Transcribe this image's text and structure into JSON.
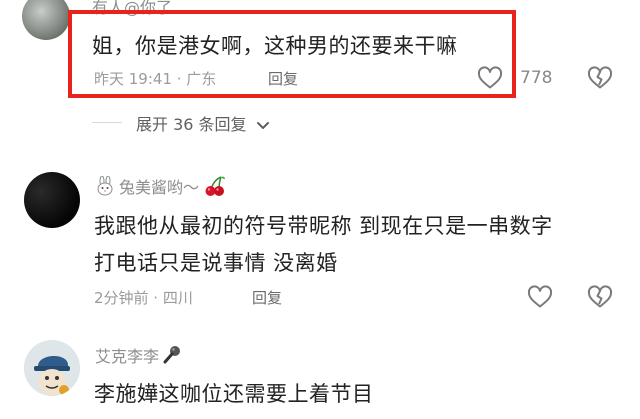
{
  "comments": [
    {
      "username": "有人@你了",
      "text": "姐，你是港女啊，这种男的还要来干嘛",
      "time_location": "昨天 19:41 · 广东",
      "reply_label": "回复",
      "like_count": "778"
    },
    {
      "username": "兔美酱哟～",
      "line1": "我跟他从最初的符号带昵称 到现在只是一串数字",
      "line2": "打电话只是说事情 没离婚",
      "time_location": "2分钟前 · 四川",
      "reply_label": "回复"
    },
    {
      "username": "艾克李李",
      "text": "李施嬅这咖位还需要上着节目"
    }
  ],
  "expand_replies": "展开 36 条回复",
  "icons": {
    "like": "heart-outline-icon",
    "dislike": "broken-heart-icon",
    "chevron": "chevron-down-icon",
    "bunny": "bunny-emoji-icon",
    "cherry": "cherry-emoji-icon",
    "mic": "microphone-emoji-icon"
  },
  "colors": {
    "highlight": "#e8231b",
    "meta": "#9b9b9b"
  }
}
